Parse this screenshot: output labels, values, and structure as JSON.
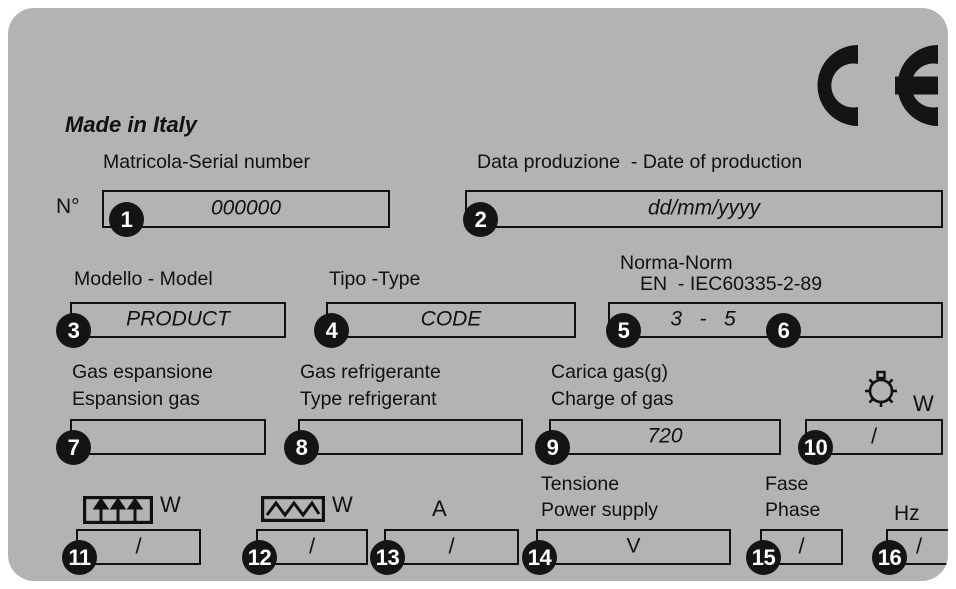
{
  "plate": {
    "made_in": "Made in Italy",
    "ce_mark": "CE"
  },
  "fields": [
    {
      "num": "1",
      "label": "Matricola-Serial number",
      "prefix": "N°",
      "value": "000000",
      "italic": true
    },
    {
      "num": "2",
      "label": "Data produzione  - Date of production",
      "value": "dd/mm/yyyy",
      "italic": true
    },
    {
      "num": "3",
      "label": "Modello - Model",
      "value": "PRODUCT",
      "italic": true
    },
    {
      "num": "4",
      "label": "Tipo -Type",
      "value": "CODE",
      "italic": true
    },
    {
      "num": "5",
      "label_line1": "Norma-Norm",
      "label_line2": "EN  - IEC60335-2-89",
      "value": "3   -   5",
      "italic": true
    },
    {
      "num": "6",
      "label": "",
      "value": ""
    },
    {
      "num": "7",
      "label_line1": "Gas espansione",
      "label_line2": "Espansion gas",
      "value": ""
    },
    {
      "num": "8",
      "label_line1": "Gas refrigerante",
      "label_line2": "Type refrigerant",
      "value": ""
    },
    {
      "num": "9",
      "label_line1": "Carica gas(g)",
      "label_line2": "Charge of gas",
      "value": "720",
      "italic": true
    },
    {
      "num": "10",
      "icon": "lamp-icon",
      "unit": "W",
      "value": "/"
    },
    {
      "num": "11",
      "icon": "fan-arrows-icon",
      "unit": "W",
      "value": "/"
    },
    {
      "num": "12",
      "icon": "heater-zigzag-icon",
      "unit": "W",
      "value": "/"
    },
    {
      "num": "13",
      "unit": "A",
      "value": "/"
    },
    {
      "num": "14",
      "label_line1": "Tensione",
      "label_line2": "Power supply",
      "value": "V"
    },
    {
      "num": "15",
      "label_line1": "Fase",
      "label_line2": "Phase",
      "value": "/"
    },
    {
      "num": "16",
      "unit": "Hz",
      "value": "/"
    }
  ],
  "colors": {
    "plate_bg": "#b3b3b3",
    "ink": "#111111",
    "badge_bg": "#141414",
    "badge_text": "#ffffff",
    "page_bg": "#ffffff"
  }
}
